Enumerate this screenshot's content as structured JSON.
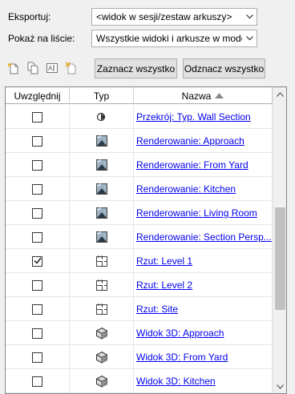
{
  "export": {
    "label": "Eksportuj:",
    "value": "<widok w sesji/zestaw arkuszy>"
  },
  "show": {
    "label": "Pokaż na liście:",
    "value": "Wszystkie widoki i arkusze w modelu"
  },
  "toolbar": {
    "icons": [
      "new-set-icon",
      "duplicate-set-icon",
      "rename-set-icon",
      "delete-set-icon"
    ],
    "select_all": "Zaznacz wszystko",
    "deselect_all": "Odznacz wszystko"
  },
  "grid": {
    "columns": [
      "Uwzględnij",
      "Typ",
      "Nazwa"
    ],
    "sort_column": "Nazwa",
    "sort_direction": "ascending",
    "rows": [
      {
        "checked": false,
        "type": "section-icon",
        "name": "Przekrój: Typ. Wall Section"
      },
      {
        "checked": false,
        "type": "rendering-icon",
        "name": "Renderowanie: Approach"
      },
      {
        "checked": false,
        "type": "rendering-icon",
        "name": "Renderowanie: From Yard"
      },
      {
        "checked": false,
        "type": "rendering-icon",
        "name": "Renderowanie: Kitchen"
      },
      {
        "checked": false,
        "type": "rendering-icon",
        "name": "Renderowanie: Living Room"
      },
      {
        "checked": false,
        "type": "rendering-icon",
        "name": "Renderowanie: Section Persp..."
      },
      {
        "checked": true,
        "type": "floor-plan-icon",
        "name": "Rzut: Level 1"
      },
      {
        "checked": false,
        "type": "floor-plan-icon",
        "name": "Rzut: Level 2"
      },
      {
        "checked": false,
        "type": "floor-plan-icon",
        "name": "Rzut: Site"
      },
      {
        "checked": false,
        "type": "3d-view-icon",
        "name": "Widok 3D: Approach"
      },
      {
        "checked": false,
        "type": "3d-view-icon",
        "name": "Widok 3D: From Yard"
      },
      {
        "checked": false,
        "type": "3d-view-icon",
        "name": "Widok 3D: Kitchen"
      }
    ]
  },
  "colors": {
    "link": "#0000ee",
    "background": "#f0f0f0"
  }
}
